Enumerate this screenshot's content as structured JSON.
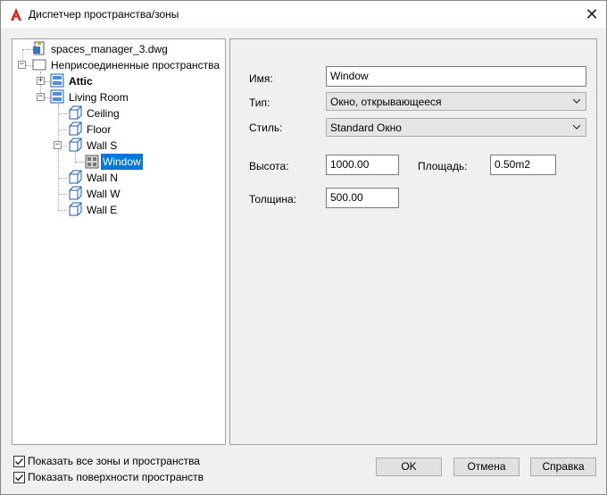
{
  "window": {
    "title": "Диспетчер пространства/зоны",
    "close_glyph": "✕"
  },
  "tree": {
    "root": "spaces_manager_3.dwg",
    "unattached": "Неприсоединенные пространства",
    "attic": "Attic",
    "living_room": "Living Room",
    "ceiling": "Ceiling",
    "floor": "Floor",
    "wall_s": "Wall S",
    "window": "Window",
    "wall_n": "Wall N",
    "wall_w": "Wall W",
    "wall_e": "Wall E",
    "expand_glyph": "+",
    "collapse_glyph": "−"
  },
  "props": {
    "name_label": "Имя:",
    "name_value": "Window",
    "type_label": "Тип:",
    "type_value": "Окно, открывающееся",
    "style_label": "Стиль:",
    "style_value": "Standard Окно",
    "height_label": "Высота:",
    "height_value": "1000.00",
    "area_label": "Площадь:",
    "area_value": "0.50m2",
    "thickness_label": "Толщина:",
    "thickness_value": "500.00"
  },
  "options": {
    "show_all_label": "Показать все зоны и пространства",
    "show_all_checked": true,
    "show_surfaces_label": "Показать поверхности пространств",
    "show_surfaces_checked": true
  },
  "buttons": {
    "ok": "OK",
    "cancel": "Отмена",
    "help": "Справка"
  },
  "colors": {
    "selection": "#0078d7",
    "app_icon": "#d9241c"
  }
}
